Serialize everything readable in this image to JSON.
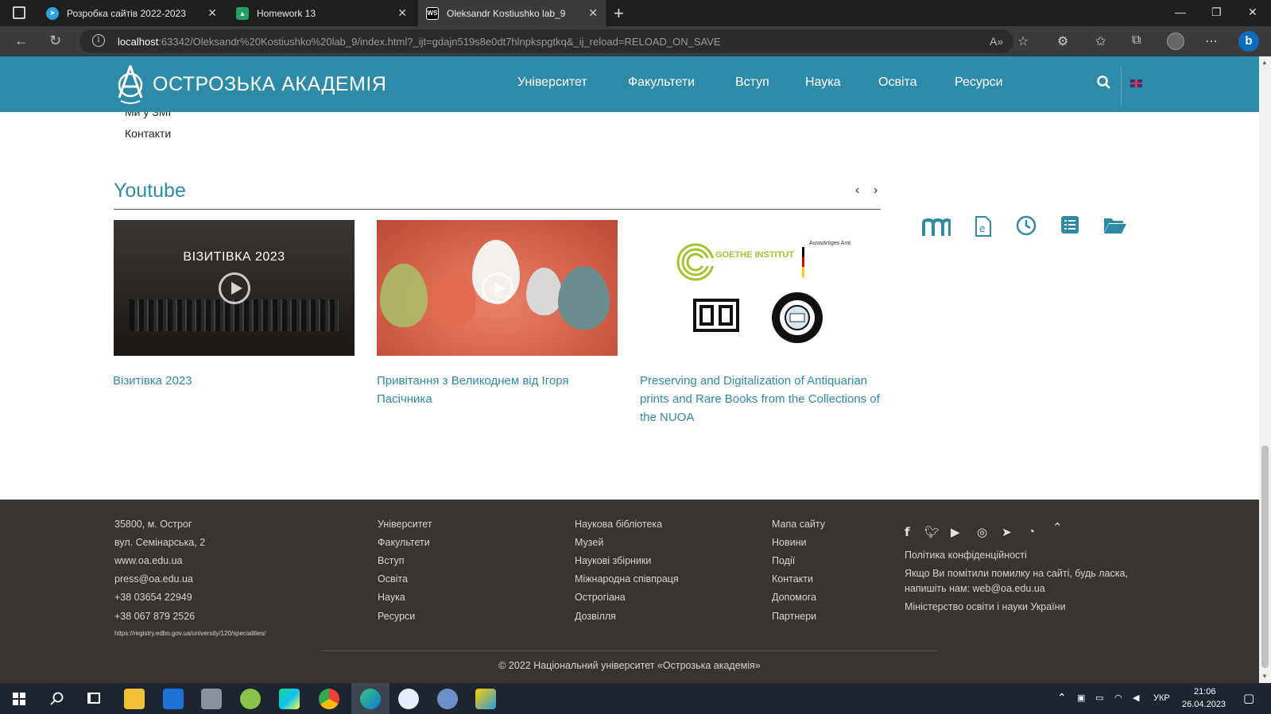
{
  "browser": {
    "tabs": [
      {
        "title": "Розробка сайтів 2022-2023",
        "icon": "telegram-icon"
      },
      {
        "title": "Homework 13",
        "icon": "classroom-icon"
      },
      {
        "title": "Oleksandr Kostiushko lab_9",
        "icon": "webstorm-icon"
      }
    ],
    "url_host": "localhost",
    "url_rest": ":63342/Oleksandr%20Kostiushko%20lab_9/index.html?_ijt=gdajn519s8e0dt7hlnpkspgtkq&_ij_reload=RELOAD_ON_SAVE"
  },
  "header": {
    "logo_text": "ОСТРОЗЬКА АКАДЕМІЯ",
    "nav": [
      "Університет",
      "Факультети",
      "Вступ",
      "Наука",
      "Освіта",
      "Ресурси"
    ]
  },
  "side_links": [
    "Ми у ЗМІ",
    "Контакти"
  ],
  "youtube": {
    "title": "Youtube",
    "videos": [
      {
        "overlay": "ВІЗИТІВКА 2023",
        "caption": "Візитівка 2023"
      },
      {
        "overlay": "",
        "caption": "Привітання з Великоднем від Ігоря Пасічника"
      },
      {
        "overlay": "",
        "caption": "Preserving and Digitalization of Antiquarian prints and Rare Books from the Collections of the NUOA"
      }
    ],
    "logos": {
      "goethe": "GOETHE INSTITUT",
      "aa": "Auswärtiges Amt"
    }
  },
  "quick_icons": [
    "moodle-icon",
    "e-document-icon",
    "clock-icon",
    "list-icon",
    "folder-open-icon"
  ],
  "footer": {
    "contacts": [
      "35800, м. Острог",
      "вул. Семінарська, 2",
      "www.oa.edu.ua",
      "press@oa.edu.ua",
      "+38 03654 22949",
      "+38 067 879 2526",
      "https://registry.edbo.gov.ua/university/120/specialities/"
    ],
    "col2": [
      "Університет",
      "Факультети",
      "Вступ",
      "Освіта",
      "Наука",
      "Ресурси"
    ],
    "col3": [
      "Наукова бібліотека",
      "Музей",
      "Наукові збірники",
      "Міжнародна співпраця",
      "Острогіана",
      "Дозвілля"
    ],
    "col4": [
      "Мапа сайту",
      "Новини",
      "Події",
      "Контакти",
      "Допомога",
      "Партнери"
    ],
    "social": [
      "facebook-icon",
      "twitter-icon",
      "youtube-icon",
      "instagram-icon",
      "telegram-icon",
      "rss-icon",
      "chevron-up-icon"
    ],
    "col5": [
      "Політика конфіденційності",
      "Якщо Ви помітили помилку на сайті, будь ласка,",
      "напишіть нам: web@oa.edu.ua",
      "Міністерство освіти і науки України"
    ],
    "copyright": "© 2022 Національний університет «Острозька академія»"
  },
  "taskbar": {
    "lang": "УКР",
    "time": "21:06",
    "date": "26.04.2023"
  },
  "colors": {
    "accent": "#2e8ba8",
    "footer_bg": "#3a3431"
  }
}
